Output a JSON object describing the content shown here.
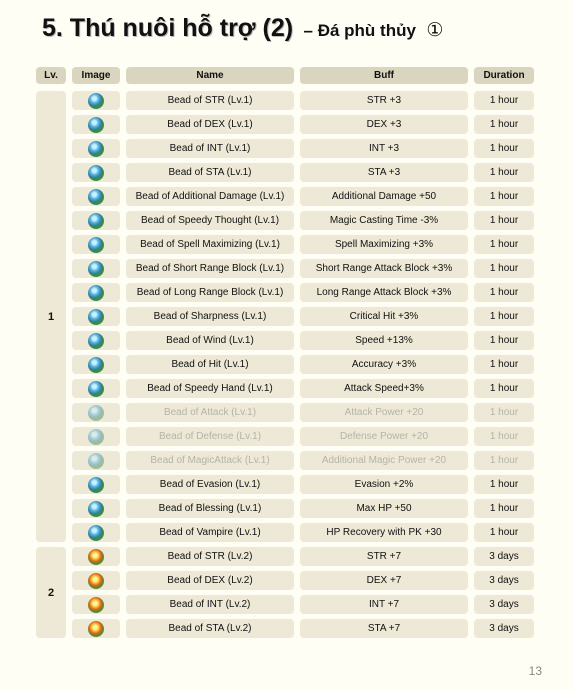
{
  "title": {
    "main": "5.  Thú nuôi hỗ trợ (2)",
    "sub": "– Đá phù thủy",
    "marker": "①"
  },
  "headers": [
    "Lv.",
    "Image",
    "Name",
    "Buff",
    "Duration"
  ],
  "levels": [
    {
      "label": "1"
    },
    {
      "label": "2"
    }
  ],
  "rows": [
    {
      "name": "Bead of STR (Lv.1)",
      "buff": "STR +3",
      "duration": "1 hour",
      "icon": "bead-green-icon"
    },
    {
      "name": "Bead of DEX (Lv.1)",
      "buff": "DEX +3",
      "duration": "1 hour",
      "icon": "bead-green-icon"
    },
    {
      "name": "Bead of INT (Lv.1)",
      "buff": "INT +3",
      "duration": "1 hour",
      "icon": "bead-green-icon"
    },
    {
      "name": "Bead of STA (Lv.1)",
      "buff": "STA +3",
      "duration": "1 hour",
      "icon": "bead-green-icon"
    },
    {
      "name": "Bead of Additional Damage (Lv.1)",
      "buff": "Additional Damage +50",
      "duration": "1 hour",
      "icon": "bead-green-icon"
    },
    {
      "name": "Bead of Speedy Thought (Lv.1)",
      "buff": "Magic Casting Time -3%",
      "duration": "1 hour",
      "icon": "bead-green-icon"
    },
    {
      "name": "Bead of Spell Maximizing (Lv.1)",
      "buff": "Spell Maximizing +3%",
      "duration": "1 hour",
      "icon": "bead-green-icon"
    },
    {
      "name": "Bead of Short Range Block (Lv.1)",
      "buff": "Short Range Attack Block +3%",
      "duration": "1 hour",
      "icon": "bead-green-icon"
    },
    {
      "name": "Bead of Long Range Block (Lv.1)",
      "buff": "Long Range Attack Block +3%",
      "duration": "1 hour",
      "icon": "bead-green-icon"
    },
    {
      "name": "Bead of Sharpness (Lv.1)",
      "buff": "Critical Hit +3%",
      "duration": "1 hour",
      "icon": "bead-green-icon"
    },
    {
      "name": "Bead of Wind (Lv.1)",
      "buff": "Speed +13%",
      "duration": "1 hour",
      "icon": "bead-green-icon"
    },
    {
      "name": "Bead of Hit (Lv.1)",
      "buff": "Accuracy +3%",
      "duration": "1 hour",
      "icon": "bead-green-icon"
    },
    {
      "name": "Bead of Speedy Hand (Lv.1)",
      "buff": "Attack Speed+3%",
      "duration": "1 hour",
      "icon": "bead-green-icon"
    },
    {
      "name": "Bead of Attack (Lv.1)",
      "buff": "Attack Power +20",
      "duration": "1 hour",
      "icon": "bead-green-icon",
      "faded": true
    },
    {
      "name": "Bead of Defense (Lv.1)",
      "buff": "Defense Power +20",
      "duration": "1 hour",
      "icon": "bead-green-icon",
      "faded": true
    },
    {
      "name": "Bead of MagicAttack (Lv.1)",
      "buff": "Additional Magic Power +20",
      "duration": "1 hour",
      "icon": "bead-green-icon",
      "faded": true
    },
    {
      "name": "Bead of Evasion (Lv.1)",
      "buff": "Evasion +2%",
      "duration": "1 hour",
      "icon": "bead-green-icon"
    },
    {
      "name": "Bead of Blessing (Lv.1)",
      "buff": "Max HP +50",
      "duration": "1 hour",
      "icon": "bead-green-icon"
    },
    {
      "name": "Bead of Vampire (Lv.1)",
      "buff": "HP Recovery with PK +30",
      "duration": "1 hour",
      "icon": "bead-green-icon"
    },
    {
      "name": "Bead of STR (Lv.2)",
      "buff": "STR +7",
      "duration": "3 days",
      "icon": "bead-fire-icon"
    },
    {
      "name": "Bead of DEX (Lv.2)",
      "buff": "DEX +7",
      "duration": "3 days",
      "icon": "bead-fire-icon"
    },
    {
      "name": "Bead of INT (Lv.2)",
      "buff": "INT +7",
      "duration": "3 days",
      "icon": "bead-fire-icon"
    },
    {
      "name": "Bead of STA (Lv.2)",
      "buff": "STA +7",
      "duration": "3 days",
      "icon": "bead-fire-icon"
    }
  ],
  "page_number": "13"
}
